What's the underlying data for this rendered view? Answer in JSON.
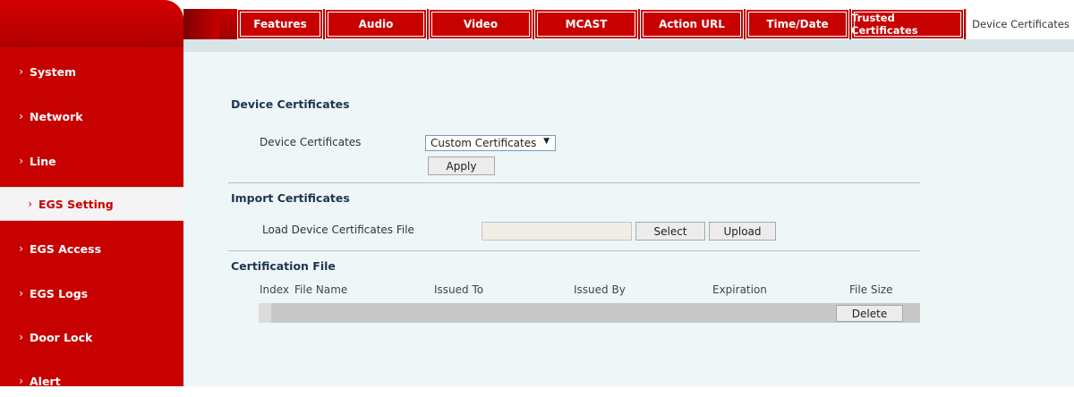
{
  "sidebar": {
    "items": [
      {
        "label": "System"
      },
      {
        "label": "Network"
      },
      {
        "label": "Line"
      },
      {
        "label": "EGS Setting"
      },
      {
        "label": "EGS Access"
      },
      {
        "label": "EGS Logs"
      },
      {
        "label": "Door Lock"
      },
      {
        "label": "Alert"
      }
    ],
    "chevron": "›",
    "active_color": "#c70000"
  },
  "tabs": [
    {
      "label": "Features"
    },
    {
      "label": "Audio"
    },
    {
      "label": "Video"
    },
    {
      "label": "MCAST"
    },
    {
      "label": "Action URL"
    },
    {
      "label": "Time/Date"
    },
    {
      "label": "Trusted Certificates"
    },
    {
      "label": "Device Certificates"
    }
  ],
  "device_certificates": {
    "title": "Device Certificates",
    "field_label": "Device Certificates",
    "select_value": "Custom Certificates",
    "select_arrow": "▼",
    "apply_label": "Apply"
  },
  "import_certificates": {
    "title": "Import Certificates",
    "field_label": "Load Device Certificates File",
    "file_value": "",
    "select_label": "Select",
    "upload_label": "Upload"
  },
  "certification_file": {
    "title": "Certification File",
    "columns": [
      "Index",
      "File Name",
      "Issued To",
      "Issued By",
      "Expiration",
      "File Size"
    ],
    "delete_label": "Delete"
  }
}
